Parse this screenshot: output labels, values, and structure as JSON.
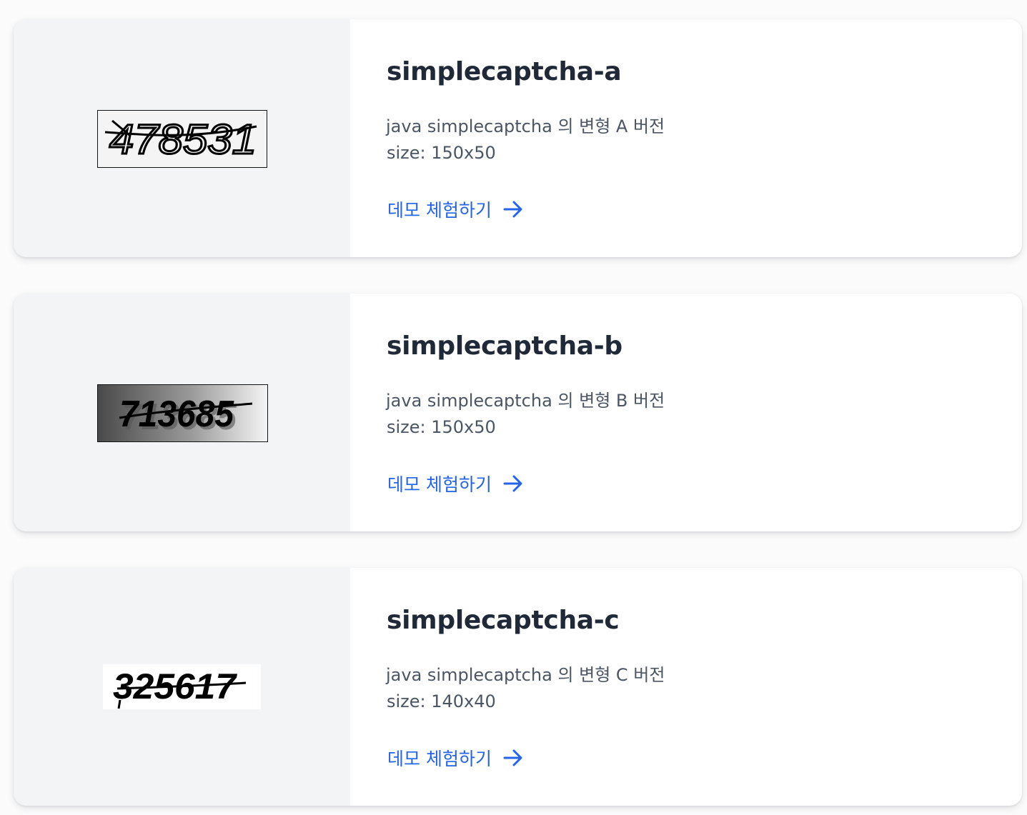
{
  "cards": [
    {
      "title": "simplecaptcha-a",
      "description": "java simplecaptcha 의 변형 A 버전",
      "size": "size: 150x50",
      "link": "데모 체험하기",
      "captcha_text": "478531"
    },
    {
      "title": "simplecaptcha-b",
      "description": "java simplecaptcha 의 변형 B 버전",
      "size": "size: 150x50",
      "link": "데모 체험하기",
      "captcha_text": "713685"
    },
    {
      "title": "simplecaptcha-c",
      "description": "java simplecaptcha 의 변형 C 버전",
      "size": "size: 140x40",
      "link": "데모 체험하기",
      "captcha_text": "325617"
    }
  ],
  "link_icon": "arrow-right-icon",
  "colors": {
    "link": "#2563eb",
    "title": "#1f2937",
    "text": "#4b5563",
    "media_bg": "#f3f4f6"
  }
}
